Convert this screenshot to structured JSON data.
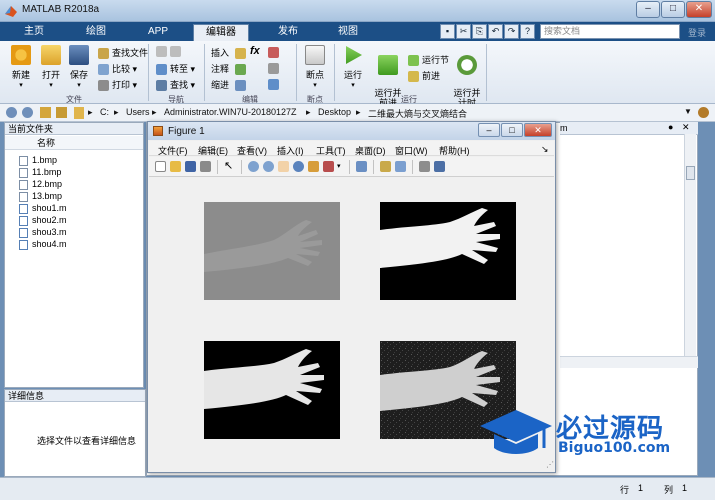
{
  "window": {
    "title": "MATLAB R2018a",
    "minimize": "–",
    "maximize": "□",
    "close": "✕"
  },
  "tabs": [
    {
      "label": "主页"
    },
    {
      "label": "绘图"
    },
    {
      "label": "APP"
    },
    {
      "label": "编辑器"
    },
    {
      "label": "发布"
    },
    {
      "label": "视图"
    }
  ],
  "search": {
    "placeholder": "搜索文档"
  },
  "signin": "登录",
  "ribbon": {
    "file": {
      "new": "新建",
      "open": "打开",
      "save": "保存",
      "find_files": "查找文件",
      "compare": "比较",
      "print": "打印",
      "group": "文件"
    },
    "navigate": {
      "goto": "转至",
      "find": "查找",
      "group": "导航"
    },
    "edit": {
      "insert": "插入",
      "comment": "注释",
      "indent": "缩进",
      "fx": "fx",
      "group": "编辑"
    },
    "breakpoints": {
      "label": "断点",
      "group": "断点"
    },
    "run": {
      "run": "运行",
      "run_advance": "运行并\n前进",
      "run_section": "运行节",
      "advance": "前进",
      "run_time": "运行并\n计时",
      "group": "运行"
    }
  },
  "address": {
    "drive": "C:",
    "users": "Users",
    "admin": "Administrator.WIN7U-20180127Z",
    "desktop": "Desktop",
    "folder": "二维最大熵与交叉熵结合",
    "sep": "▸"
  },
  "current_folder": {
    "title": "当前文件夹",
    "column": "名称",
    "files": [
      "1.bmp",
      "11.bmp",
      "12.bmp",
      "13.bmp",
      "shou1.m",
      "shou2.m",
      "shou3.m",
      "shou4.m"
    ]
  },
  "details": {
    "title": "详细信息",
    "message": "选择文件以查看详细信息"
  },
  "figure": {
    "title": "Figure 1",
    "menus": [
      "文件(F)",
      "编辑(E)",
      "查看(V)",
      "插入(I)",
      "工具(T)",
      "桌面(D)",
      "窗口(W)",
      "帮助(H)"
    ]
  },
  "right_fragment": "m",
  "status": {
    "row_label": "行",
    "row": "1",
    "col_label": "列",
    "col": "1"
  },
  "watermark": {
    "text": "必过源码",
    "sub": "Biguo100.com"
  },
  "colors": {
    "tab_strip": "#1c4f86",
    "accent": "#1b64c6"
  }
}
